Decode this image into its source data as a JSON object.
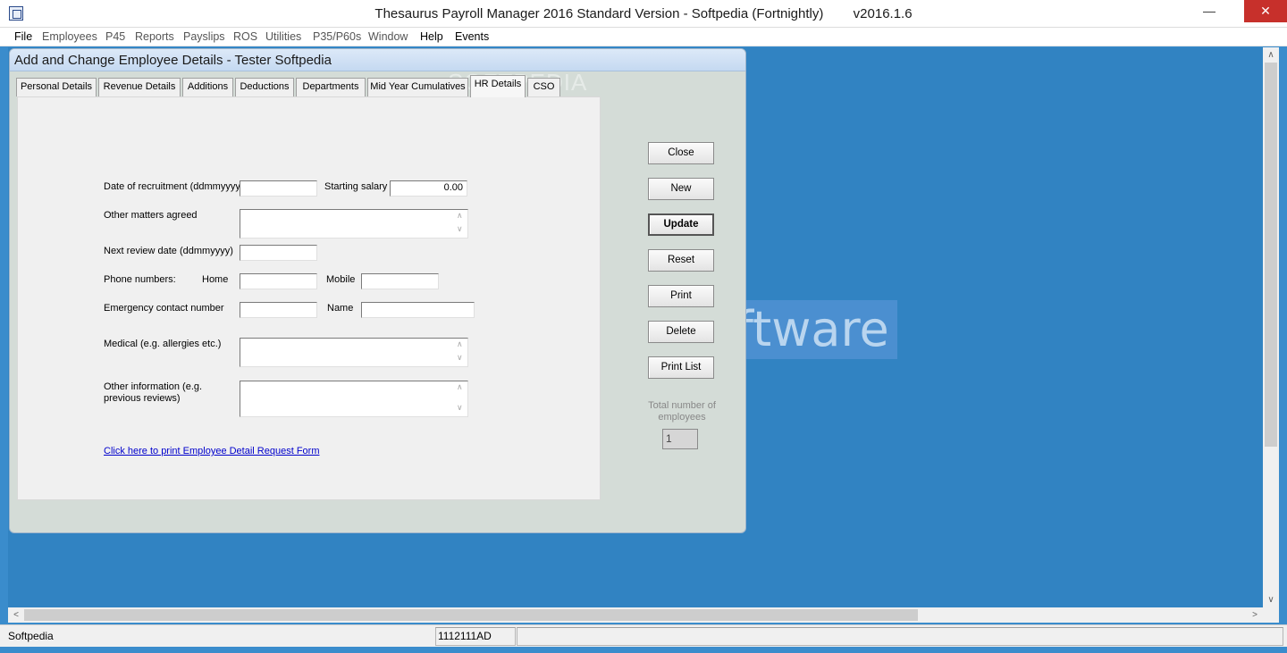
{
  "window": {
    "title": "Thesaurus Payroll Manager 2016 Standard Version - Softpedia (Fortnightly)        v2016.1.6",
    "minimize_glyph": "—",
    "maximize_glyph": "☐",
    "close_glyph": "✕"
  },
  "menu": [
    "File",
    "Employees",
    "P45",
    "Reports",
    "Payslips",
    "ROS",
    "Utilities",
    "P35/P60s",
    "Window",
    "Help",
    "Events"
  ],
  "background_watermark": "ftware",
  "child": {
    "title": "Add and Change Employee Details - Tester Softpedia",
    "tab_watermark": "SOFTPEDIA",
    "tabs": [
      "Personal Details",
      "Revenue Details",
      "Additions",
      "Deductions",
      "Departments",
      "Mid Year Cumulatives",
      "HR Details",
      "CSO"
    ],
    "active_tab": "HR Details"
  },
  "form": {
    "date_recruitment_label": "Date of recruitment (ddmmyyyy)",
    "date_recruitment_value": "",
    "starting_salary_label": "Starting salary",
    "starting_salary_value": "0.00",
    "other_matters_label": "Other matters agreed",
    "next_review_label": "Next review date (ddmmyyyy)",
    "phone_label": "Phone numbers:",
    "home_label": "Home",
    "mobile_label": "Mobile",
    "emergency_label": "Emergency contact number",
    "name_label": "Name",
    "medical_label": "Medical (e.g. allergies etc.)",
    "other_info_label": "Other information (e.g. previous reviews)",
    "print_link": "Click here to print Employee Detail Request Form"
  },
  "buttons": {
    "close": "Close",
    "new": "New",
    "update": "Update",
    "reset": "Reset",
    "print": "Print",
    "delete": "Delete",
    "print_list": "Print List"
  },
  "total": {
    "label": "Total number of employees",
    "value": "1"
  },
  "status": {
    "left": "Softpedia",
    "middle": "1112111AD",
    "right": ""
  },
  "scroll": {
    "up": "∧",
    "down": "∨",
    "left": "<",
    "right": ">"
  }
}
